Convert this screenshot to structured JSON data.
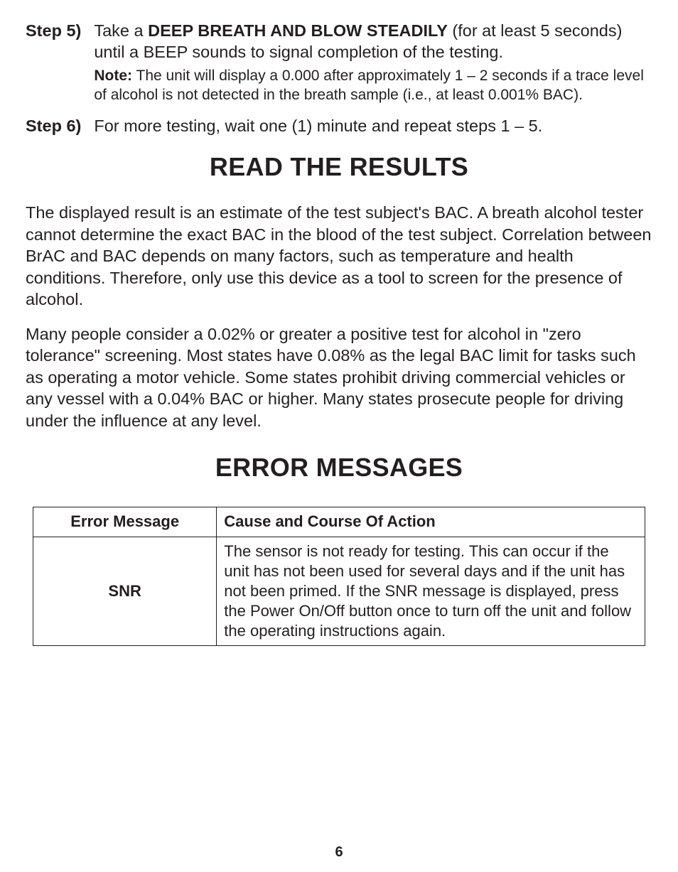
{
  "steps": {
    "s5": {
      "label": "Step 5)",
      "pre": "Take a ",
      "bold": "DEEP BREATH AND BLOW STEADILY",
      "post": " (for at least 5 seconds) until a BEEP sounds to signal completion of the testing.",
      "note_label": "Note:",
      "note_text": " The unit will display a 0.000 after approximately 1 – 2 seconds if a trace level of alcohol is not detected in the breath sample (i.e., at least 0.001% BAC)."
    },
    "s6": {
      "label": "Step 6)",
      "text": "For more testing, wait one (1) minute and repeat steps 1 – 5."
    }
  },
  "headings": {
    "results": "READ THE RESULTS",
    "errors": "ERROR MESSAGES"
  },
  "body": {
    "p1": "The displayed result is an estimate of the test subject's BAC. A breath alcohol tester cannot determine the exact BAC in the blood of the test subject.  Correlation between BrAC and BAC depends on many factors, such as temperature and health conditions. Therefore, only use this device as a tool to screen for the presence of alcohol.",
    "p2": "Many people consider a 0.02% or greater a positive test for alcohol in \"zero tolerance\" screening. Most states have 0.08% as the legal BAC limit for tasks such as operating a motor vehicle. Some states prohibit driving commercial vehicles or any vessel with a 0.04% BAC or higher. Many states prosecute people for driving under the influence at any level."
  },
  "table": {
    "col1": "Error Message",
    "col2": "Cause and Course Of Action",
    "row1": {
      "msg": "SNR",
      "cause": "The sensor is not ready for testing. This can occur if the unit has not been used for several days and if the unit has not been primed. If the SNR message is displayed, press the Power On/Off button once to turn off the unit and follow the operating instructions again."
    }
  },
  "page": "6"
}
